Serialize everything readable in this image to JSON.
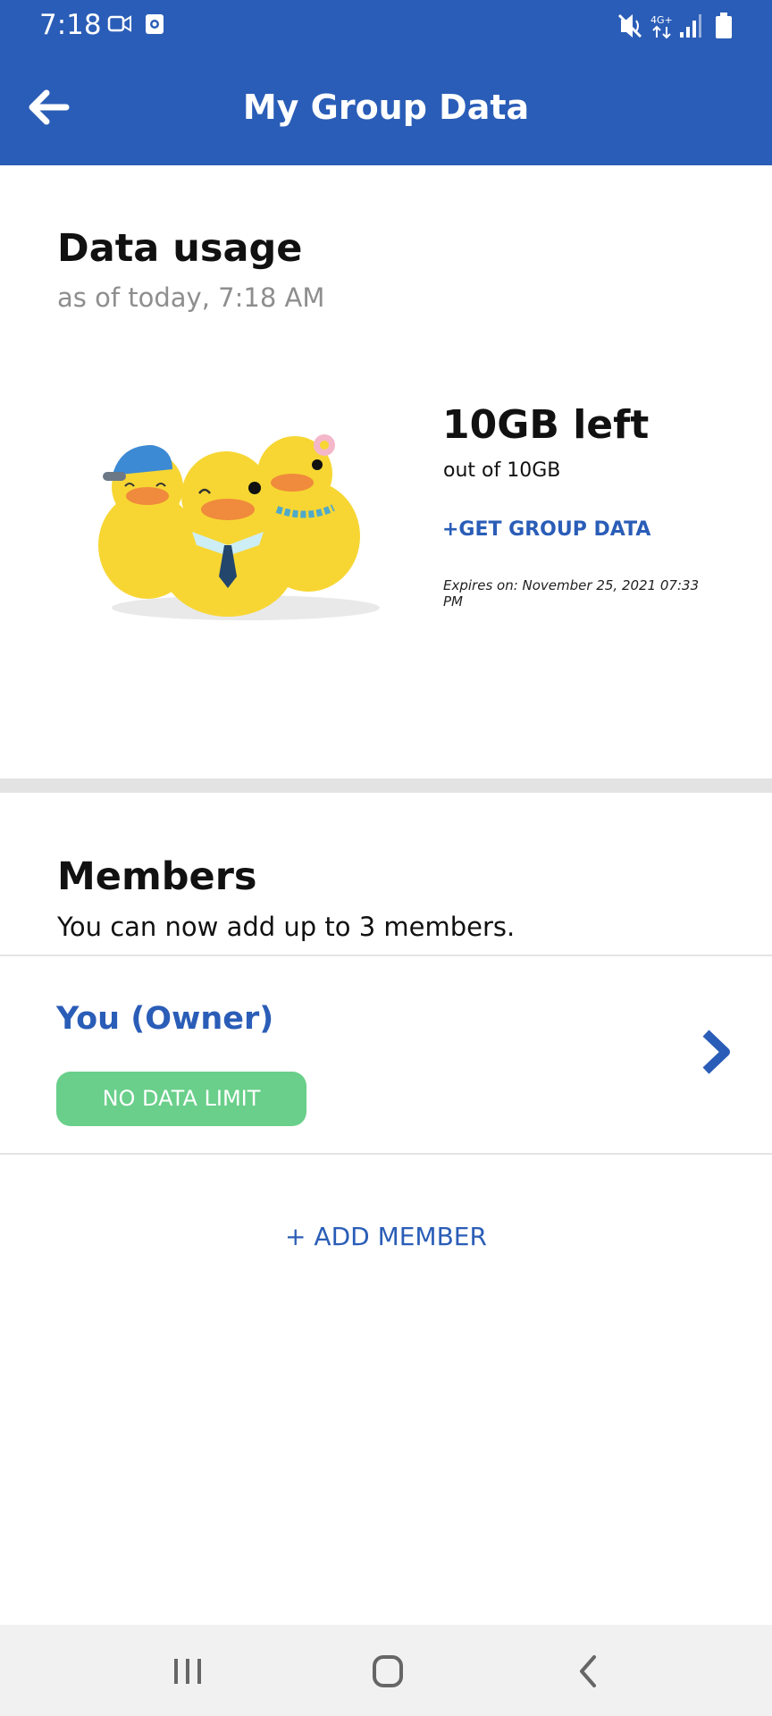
{
  "status_bar": {
    "time": "7:18",
    "icons": [
      "video-camera-icon",
      "screen-record-icon",
      "mute-vibrate-icon",
      "4g-plus-icon",
      "signal-icon",
      "battery-icon"
    ]
  },
  "app_bar": {
    "title": "My Group Data",
    "back_icon": "arrow-left-icon"
  },
  "usage": {
    "title": "Data usage",
    "subtitle": "as of today, 7:18 AM",
    "amount_left": "10GB left",
    "out_of": "out of 10GB",
    "get_group_data": "+GET GROUP DATA",
    "expires": "Expires on: November 25, 2021 07:33 PM"
  },
  "members": {
    "title": "Members",
    "subtitle": "You can now add up to 3 members.",
    "owner": {
      "name": "You (Owner)",
      "badge": "NO DATA LIMIT"
    },
    "add_member": "+ ADD MEMBER"
  },
  "nav_bar": {
    "icons": [
      "recents-icon",
      "home-icon",
      "back-icon"
    ]
  },
  "colors": {
    "primary": "#2a5db7",
    "badge": "#69cf8a",
    "divider": "#e3e3e3",
    "nav_background": "#f1f1f1"
  }
}
